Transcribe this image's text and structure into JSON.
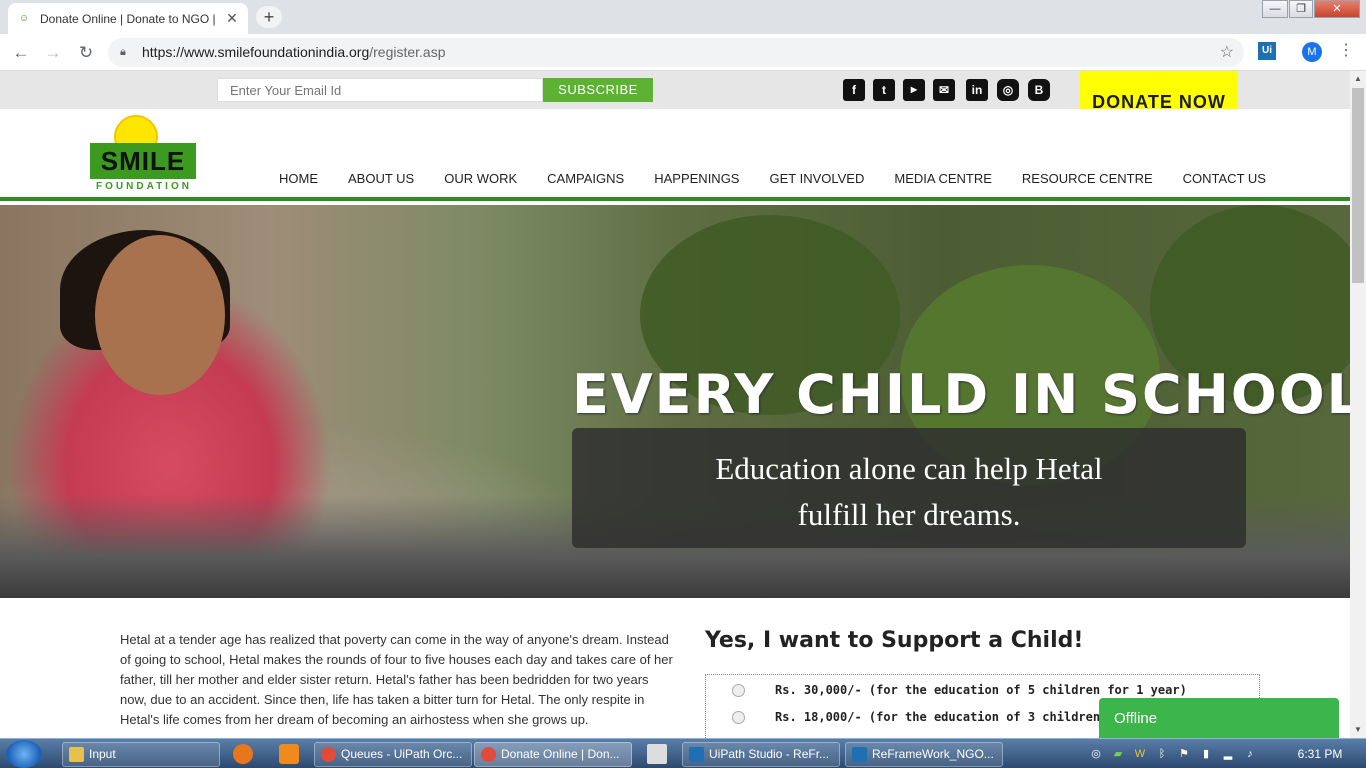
{
  "browser": {
    "tab_title": "Donate Online | Donate to NGO |",
    "tab_close": "✕",
    "new_tab": "+",
    "url_host": "https://www.smilefoundationindia.org",
    "url_path": "/register.asp",
    "extension_label": "Ui",
    "profile_initial": "M",
    "window_controls": {
      "minimize": "—",
      "maximize": "❐",
      "close": "✕"
    }
  },
  "topbar": {
    "email_placeholder": "Enter Your Email Id",
    "subscribe_label": "SUBSCRIBE",
    "social_icons": [
      "facebook-icon",
      "twitter-icon",
      "youtube-icon",
      "email-icon",
      "linkedin-icon",
      "instagram-icon",
      "blogger-icon"
    ],
    "donate_label": "DONATE NOW"
  },
  "logo": {
    "word": "SMILE",
    "sub": "FOUNDATION"
  },
  "nav": {
    "items": [
      "HOME",
      "ABOUT US",
      "OUR WORK",
      "CAMPAIGNS",
      "HAPPENINGS",
      "GET INVOLVED",
      "MEDIA CENTRE",
      "RESOURCE CENTRE",
      "CONTACT US"
    ]
  },
  "hero": {
    "headline": "EVERY CHILD IN SCHOOL",
    "caption_line1": "Education alone can help Hetal",
    "caption_line2": "fulfill her dreams."
  },
  "content": {
    "story": "Hetal at a tender age has realized that poverty can come in the way of anyone's dream. Instead of going to school, Hetal makes the rounds of four to five houses each day and takes care of her father, till her mother and elder sister return. Hetal's father has been bedridden for two years now, due to an accident. Since then, life has taken a bitter turn for Hetal. The only respite in Hetal's life comes from her dream of becoming an airhostess when she grows up.",
    "support_title": "Yes, I want to Support a Child!",
    "option1": "Rs. 30,000/- (for the education of 5 children for 1 year)",
    "option2": "Rs. 18,000/- (for the education of 3 children for 1 year)",
    "chat_status": "Offline"
  },
  "taskbar": {
    "tasks": [
      "Input",
      "Queues - UiPath Orc...",
      "Donate Online | Don...",
      "UiPath Studio - ReFr...",
      "ReFrameWork_NGO..."
    ],
    "clock": "6:31 PM"
  }
}
